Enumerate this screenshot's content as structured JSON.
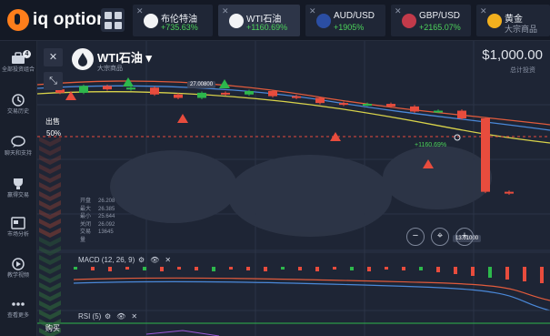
{
  "brand": "iq option",
  "tabs": [
    {
      "name": "布伦特油",
      "change": "+735.63%",
      "icon": "oil-drop-icon"
    },
    {
      "name": "WTI石油",
      "change": "+1160.69%",
      "icon": "oil-drop-icon",
      "active": true
    },
    {
      "name": "AUD/USD",
      "change": "+1905%",
      "icon": "flag-au-icon"
    },
    {
      "name": "GBP/USD",
      "change": "+2165.07%",
      "icon": "flag-gb-icon"
    },
    {
      "name": "黄金",
      "change": "大宗商品",
      "icon": "gold-icon"
    }
  ],
  "sidebar": [
    {
      "label": "全部投资组合",
      "badge": "4"
    },
    {
      "label": "交易历史"
    },
    {
      "label": "聊天和支持"
    },
    {
      "label": "赢得交易"
    },
    {
      "label": "市场分析"
    },
    {
      "label": "教学视频"
    },
    {
      "label": "查看更多"
    }
  ],
  "asset": {
    "name": "WTI石油 ▾",
    "category": "大宗商品"
  },
  "balance": {
    "amount": "$1,000.00",
    "label": "总计投资"
  },
  "trade": {
    "sell_label": "出售",
    "sell_pct": "50%",
    "buy_label": "购买"
  },
  "stats": [
    {
      "k": "开盘",
      "v": "26.208"
    },
    {
      "k": "最大",
      "v": "26.385"
    },
    {
      "k": "最小",
      "v": "25.644"
    },
    {
      "k": "关闭",
      "v": "26.092"
    },
    {
      "k": "交易量",
      "v": "13645"
    }
  ],
  "prices": {
    "high_tag": "27.00800",
    "low_tag": "13.01000"
  },
  "profit": "+1160.69%",
  "indicators": {
    "macd": "MACD (12, 26, 9)",
    "rsi": "RSI (5)"
  },
  "zoom": {
    "out": "−",
    "in": "+"
  },
  "chart_data": {
    "type": "candlestick",
    "candles": [
      {
        "o": 26.5,
        "c": 26.3
      },
      {
        "o": 26.3,
        "c": 26.7
      },
      {
        "o": 26.7,
        "c": 26.5
      },
      {
        "o": 26.5,
        "c": 26.6
      },
      {
        "o": 26.6,
        "c": 26.2
      },
      {
        "o": 26.2,
        "c": 26.0
      },
      {
        "o": 26.0,
        "c": 26.3
      },
      {
        "o": 26.3,
        "c": 26.2
      },
      {
        "o": 26.2,
        "c": 26.4
      },
      {
        "o": 26.4,
        "c": 26.1
      },
      {
        "o": 26.1,
        "c": 26.0
      },
      {
        "o": 26.0,
        "c": 25.7
      },
      {
        "o": 25.7,
        "c": 25.6
      },
      {
        "o": 25.6,
        "c": 25.65
      },
      {
        "o": 25.65,
        "c": 25.5
      },
      {
        "o": 25.5,
        "c": 25.2
      },
      {
        "o": 25.2,
        "c": 25.25
      },
      {
        "o": 25.25,
        "c": 24.8
      },
      {
        "o": 24.8,
        "c": 20.5
      },
      {
        "o": 20.5,
        "c": 20.4
      }
    ]
  },
  "colors": {
    "up": "#2db84c",
    "down": "#e84c3d",
    "accent": "#ff7e1b"
  }
}
